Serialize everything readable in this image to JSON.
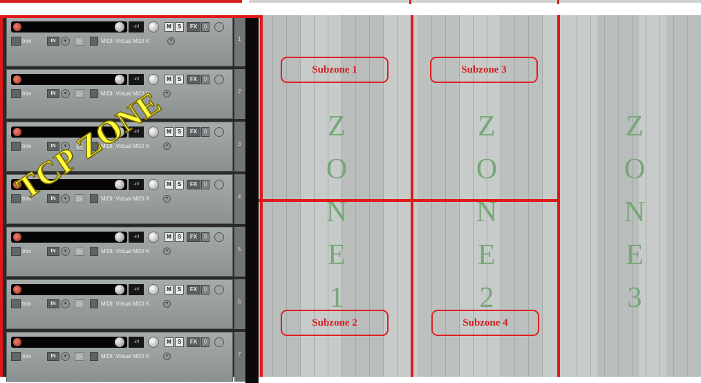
{
  "tcp": {
    "zone_label": "TCP ZONE",
    "tracks": [
      {
        "number": "1",
        "meter": "-inf",
        "mute": "M",
        "solo": "S",
        "fx": "FX",
        "fx_toggle": "0",
        "trim": "trim",
        "input": "IN",
        "input_arrow": "▾",
        "play": "▷",
        "midi_label": "MIDI: Virtual MIDI K",
        "midi_arrow": "▾"
      },
      {
        "number": "2",
        "meter": "-inf",
        "mute": "M",
        "solo": "S",
        "fx": "FX",
        "fx_toggle": "0",
        "trim": "trim",
        "input": "IN",
        "input_arrow": "▾",
        "play": "▷",
        "midi_label": "MIDI: Virtual MIDI K",
        "midi_arrow": "▾"
      },
      {
        "number": "3",
        "meter": "-inf",
        "mute": "M",
        "solo": "S",
        "fx": "FX",
        "fx_toggle": "0",
        "trim": "trim",
        "input": "IN",
        "input_arrow": "▾",
        "play": "▷",
        "midi_label": "MIDI: Virtual MIDI K",
        "midi_arrow": "▾"
      },
      {
        "number": "4",
        "meter": "-inf",
        "mute": "M",
        "solo": "S",
        "fx": "FX",
        "fx_toggle": "0",
        "trim": "trim",
        "input": "IN",
        "input_arrow": "▾",
        "play": "▷",
        "midi_label": "MIDI: Virtual MIDI K",
        "midi_arrow": "▾"
      },
      {
        "number": "5",
        "meter": "-inf",
        "mute": "M",
        "solo": "S",
        "fx": "FX",
        "fx_toggle": "0",
        "trim": "trim",
        "input": "IN",
        "input_arrow": "▾",
        "play": "▷",
        "midi_label": "MIDI: Virtual MIDI K",
        "midi_arrow": "▾"
      },
      {
        "number": "6",
        "meter": "-inf",
        "mute": "M",
        "solo": "S",
        "fx": "FX",
        "fx_toggle": "0",
        "trim": "trim",
        "input": "IN",
        "input_arrow": "▾",
        "play": "▷",
        "midi_label": "MIDI: Virtual MIDI K",
        "midi_arrow": "▾"
      },
      {
        "number": "7",
        "meter": "-inf",
        "mute": "M",
        "solo": "S",
        "fx": "FX",
        "fx_toggle": "0",
        "trim": "trim",
        "input": "IN",
        "input_arrow": "▾",
        "play": "▷",
        "midi_label": "MIDI: Virtual MIDI K",
        "midi_arrow": "▾"
      }
    ]
  },
  "arrange": {
    "subzones": [
      "Subzone 1",
      "Subzone 2",
      "Subzone 3",
      "Subzone 4"
    ],
    "zones": [
      {
        "letters": [
          "Z",
          "O",
          "N",
          "E",
          "1"
        ]
      },
      {
        "letters": [
          "Z",
          "O",
          "N",
          "E",
          "2"
        ]
      },
      {
        "letters": [
          "Z",
          "O",
          "N",
          "E",
          "3"
        ]
      }
    ]
  },
  "colors": {
    "zone_border": "#e01818",
    "subzone_text": "#d42020",
    "zone_letters": "#77a877",
    "tcp_label": "#ffff40"
  }
}
